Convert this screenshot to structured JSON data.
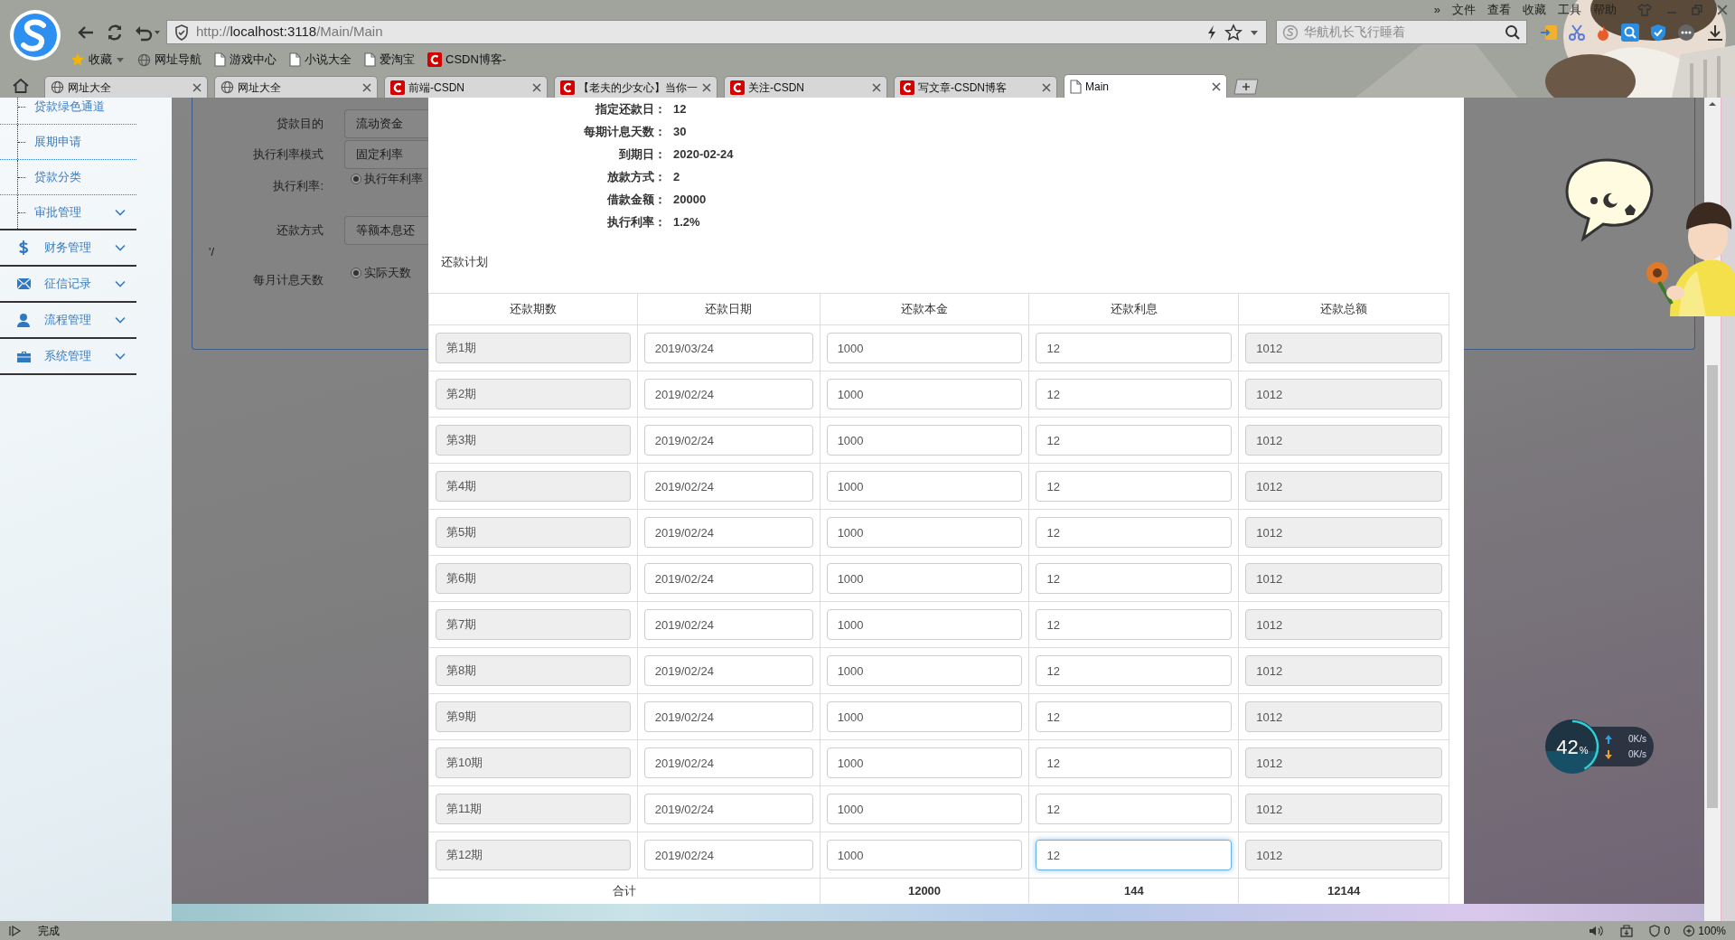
{
  "browser": {
    "menu": [
      "»",
      "文件",
      "查看",
      "收藏",
      "工具",
      "帮助"
    ],
    "url": {
      "scheme": "http://",
      "host": "localhost:3118",
      "path": "/Main/Main"
    },
    "search": {
      "placeholder": "华航机长飞行睡着"
    },
    "bookmarks": [
      {
        "label": "收藏",
        "kind": "star"
      },
      {
        "label": "网址导航",
        "kind": "globe"
      },
      {
        "label": "游戏中心",
        "kind": "page"
      },
      {
        "label": "小说大全",
        "kind": "page"
      },
      {
        "label": "爱淘宝",
        "kind": "page"
      },
      {
        "label": "CSDN博客-",
        "kind": "csdn"
      }
    ],
    "tabs": [
      {
        "label": "网址大全",
        "kind": "globe",
        "selected": false
      },
      {
        "label": "网址大全",
        "kind": "globe",
        "selected": false
      },
      {
        "label": "前端-CSDN",
        "kind": "csdn",
        "selected": false
      },
      {
        "label": "【老夫的少女心】当你一",
        "kind": "csdn",
        "selected": false
      },
      {
        "label": "关注-CSDN",
        "kind": "csdn",
        "selected": false
      },
      {
        "label": "写文章-CSDN博客",
        "kind": "csdn",
        "selected": false
      },
      {
        "label": "Main",
        "kind": "page",
        "selected": true
      }
    ]
  },
  "sidebar": {
    "items": [
      {
        "label": "贷款绿色通道",
        "kind": "sub"
      },
      {
        "label": "展期申请",
        "kind": "sub"
      },
      {
        "label": "贷款分类",
        "kind": "sub"
      },
      {
        "label": "审批管理",
        "kind": "sub-group"
      },
      {
        "label": "财务管理",
        "kind": "group"
      },
      {
        "label": "征信记录",
        "kind": "group"
      },
      {
        "label": "流程管理",
        "kind": "group"
      },
      {
        "label": "系统管理",
        "kind": "group"
      }
    ]
  },
  "form": {
    "fields": [
      {
        "label": "贷款目的",
        "kind": "select",
        "value": "流动资金"
      },
      {
        "label": "执行利率模式",
        "kind": "select",
        "value": "固定利率"
      },
      {
        "label": "执行利率:",
        "kind": "radio",
        "value": "执行年利率",
        "checked": true
      },
      {
        "label": "还款方式",
        "kind": "select",
        "value": "等额本息还"
      },
      {
        "kind": "note",
        "text": "'/"
      },
      {
        "label": "每月计息天数",
        "kind": "radio",
        "value": "实际天数",
        "checked": true
      }
    ]
  },
  "dialog": {
    "info": [
      {
        "label": "指定还款日：",
        "value": "12"
      },
      {
        "label": "每期计息天数：",
        "value": "30"
      },
      {
        "label": "到期日：",
        "value": "2020-02-24"
      },
      {
        "label": "放款方式：",
        "value": "2"
      },
      {
        "label": "借款金额：",
        "value": "20000"
      },
      {
        "label": "执行利率：",
        "value": "1.2%"
      }
    ],
    "section_title": "还款计划",
    "table": {
      "columns": [
        {
          "label": "还款期数",
          "editable": false
        },
        {
          "label": "还款日期",
          "editable": true
        },
        {
          "label": "还款本金",
          "editable": true
        },
        {
          "label": "还款利息",
          "editable": true
        },
        {
          "label": "还款总额",
          "editable": false
        }
      ],
      "rows": [
        {
          "period": "第1期",
          "date": "2019/03/24",
          "principal": "1000",
          "interest": "12",
          "total": "1012",
          "focused": false
        },
        {
          "period": "第2期",
          "date": "2019/02/24",
          "principal": "1000",
          "interest": "12",
          "total": "1012",
          "focused": false
        },
        {
          "period": "第3期",
          "date": "2019/02/24",
          "principal": "1000",
          "interest": "12",
          "total": "1012",
          "focused": false
        },
        {
          "period": "第4期",
          "date": "2019/02/24",
          "principal": "1000",
          "interest": "12",
          "total": "1012",
          "focused": false
        },
        {
          "period": "第5期",
          "date": "2019/02/24",
          "principal": "1000",
          "interest": "12",
          "total": "1012",
          "focused": false
        },
        {
          "period": "第6期",
          "date": "2019/02/24",
          "principal": "1000",
          "interest": "12",
          "total": "1012",
          "focused": false
        },
        {
          "period": "第7期",
          "date": "2019/02/24",
          "principal": "1000",
          "interest": "12",
          "total": "1012",
          "focused": false
        },
        {
          "period": "第8期",
          "date": "2019/02/24",
          "principal": "1000",
          "interest": "12",
          "total": "1012",
          "focused": false
        },
        {
          "period": "第9期",
          "date": "2019/02/24",
          "principal": "1000",
          "interest": "12",
          "total": "1012",
          "focused": false
        },
        {
          "period": "第10期",
          "date": "2019/02/24",
          "principal": "1000",
          "interest": "12",
          "total": "1012",
          "focused": false
        },
        {
          "period": "第11期",
          "date": "2019/02/24",
          "principal": "1000",
          "interest": "12",
          "total": "1012",
          "focused": false
        },
        {
          "period": "第12期",
          "date": "2019/02/24",
          "principal": "1000",
          "interest": "12",
          "total": "1012",
          "focused": true
        }
      ],
      "totals": {
        "label": "合计",
        "principal": "12000",
        "interest": "144",
        "total": "12144"
      }
    }
  },
  "speed_widget": {
    "percent": "42",
    "unit": "%",
    "level": 0.42,
    "up": "0K/s",
    "down": "0K/s"
  },
  "status_bar": {
    "text": "完成",
    "blocked": "0",
    "zoom": "100%"
  }
}
